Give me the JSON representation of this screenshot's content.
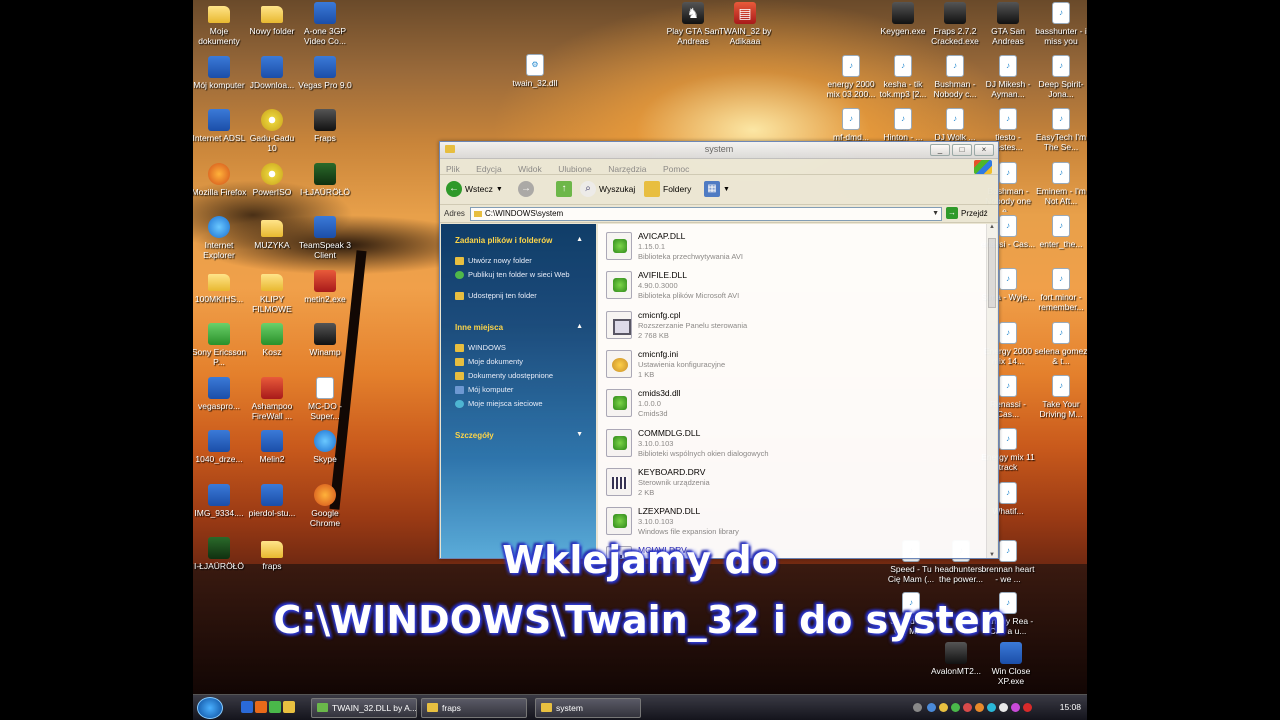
{
  "desktop": {
    "icons_left": [
      {
        "label": "Moje dokumenty",
        "icon": "folder-docs-icon"
      },
      {
        "label": "Nowy folder",
        "icon": "folder-icon"
      },
      {
        "label": "A-one 3GP Video Co...",
        "icon": "app-icon"
      },
      {
        "label": "Mój komputer",
        "icon": "computer-icon"
      },
      {
        "label": "JDownloa...",
        "icon": "jdownloader-icon"
      },
      {
        "label": "Vegas Pro 9.0",
        "icon": "vegas-icon"
      },
      {
        "label": "Internet ADSL",
        "icon": "internet-icon"
      },
      {
        "label": "Gadu-Gadu 10",
        "icon": "gadugadu-icon"
      },
      {
        "label": "Fraps",
        "icon": "fraps-icon"
      },
      {
        "label": "Mozilla Firefox",
        "icon": "firefox-icon"
      },
      {
        "label": "PowerISO",
        "icon": "poweriso-icon"
      },
      {
        "label": "I-ŁJAÜRÖŁÖ",
        "icon": "game-icon"
      },
      {
        "label": "Internet Explorer",
        "icon": "ie-icon"
      },
      {
        "label": "MUZYKA",
        "icon": "folder-icon"
      },
      {
        "label": "TeamSpeak 3 Client",
        "icon": "teamspeak-icon"
      },
      {
        "label": "100MKIHS...",
        "icon": "folder-icon"
      },
      {
        "label": "KLIPY FILMOWE",
        "icon": "folder-icon"
      },
      {
        "label": "metin2.exe",
        "icon": "metin2-icon"
      },
      {
        "label": "Sony Ericsson P...",
        "icon": "sony-icon"
      },
      {
        "label": "Kosz",
        "icon": "recycle-bin-icon"
      },
      {
        "label": "Winamp",
        "icon": "winamp-icon"
      },
      {
        "label": "vegaspro...",
        "icon": "vegas-icon"
      },
      {
        "label": "Ashampoo FireWall ...",
        "icon": "ashampoo-icon"
      },
      {
        "label": "MC-DO - Super...",
        "icon": "mp3-icon"
      },
      {
        "label": "1040_drze...",
        "icon": "image-icon"
      },
      {
        "label": "Melin2",
        "icon": "melin-icon"
      },
      {
        "label": "Skype",
        "icon": "skype-icon"
      },
      {
        "label": "IMG_9334....",
        "icon": "image-icon"
      },
      {
        "label": "pierdol-stu...",
        "icon": "image-icon"
      },
      {
        "label": "Google Chrome",
        "icon": "chrome-icon"
      },
      {
        "label": "I-ŁJAÜRÖŁÖ",
        "icon": "game-icon"
      },
      {
        "label": "fraps",
        "icon": "folder-icon"
      }
    ],
    "icons_top": [
      {
        "label": "twain_32.dll",
        "icon": "dll-icon"
      },
      {
        "label": "Play GTA San Andreas",
        "icon": "gta-icon"
      },
      {
        "label": "TWAIN_32 by Adikaaa",
        "icon": "winrar-icon"
      }
    ],
    "icons_right": [
      {
        "label": "Keygen.exe",
        "icon": "keygen-icon"
      },
      {
        "label": "Fraps 2.7.2 Cracked.exe",
        "icon": "fraps-icon"
      },
      {
        "label": "GTA San Andreas",
        "icon": "gta-icon"
      },
      {
        "label": "basshunter - i miss you",
        "icon": "mp3-icon"
      },
      {
        "label": "energy 2000 mix 03.200...",
        "icon": "mp3-icon"
      },
      {
        "label": "kesha - tik tok.mp3 [2...",
        "icon": "mp3-icon"
      },
      {
        "label": "Bushman - Nobody c...",
        "icon": "mp3-icon"
      },
      {
        "label": "DJ Mikesh - Ayman...",
        "icon": "mp3-icon"
      },
      {
        "label": "Deep Spirit-Jona...",
        "icon": "mp3-icon"
      },
      {
        "label": "mf-dmd...",
        "icon": "mp3-icon"
      },
      {
        "label": "Hinton - ...",
        "icon": "mp3-icon"
      },
      {
        "label": "DJ Wolk ...",
        "icon": "mp3-icon"
      },
      {
        "label": "tiesto - jestes...",
        "icon": "mp3-icon"
      },
      {
        "label": "EasyTech I'm The Se...",
        "icon": "mp3-icon"
      },
      {
        "label": "Bushman - Nobody one e...",
        "icon": "mp3-icon"
      },
      {
        "label": "Eminem - I'm Not Aft...",
        "icon": "mp3-icon"
      },
      {
        "label": "enassi - Cas...",
        "icon": "mp3-icon"
      },
      {
        "label": "enter_the...",
        "icon": "mp3-icon"
      },
      {
        "label": "Sima - Wyje...",
        "icon": "mp3-icon"
      },
      {
        "label": "fort.minor - remember...",
        "icon": "mp3-icon"
      },
      {
        "label": "Energy 2000 mix 14...",
        "icon": "mp3-icon"
      },
      {
        "label": "selena gomez & t...",
        "icon": "mp3-icon"
      },
      {
        "label": "Renassi - Cas...",
        "icon": "mp3-icon"
      },
      {
        "label": "Take Your Driving M...",
        "icon": "mp3-icon"
      },
      {
        "label": "Energy mix 11 track",
        "icon": "mp3-icon"
      },
      {
        "label": "Whatif...",
        "icon": "mp3-icon"
      },
      {
        "label": "Speed - Tu Cię Mam (...",
        "icon": "mp3-icon"
      },
      {
        "label": "headhunters - the power...",
        "icon": "mp3-icon"
      },
      {
        "label": "brennan heart - we ...",
        "icon": "mp3-icon"
      },
      {
        "label": "Speed - Tu Cię Ma...",
        "icon": "mp3-icon"
      },
      {
        "label": "Tammy Rea - Can a u...",
        "icon": "mp3-icon"
      },
      {
        "label": "AvalonMT2...",
        "icon": "avalon-icon"
      },
      {
        "label": "Win Close XP.exe",
        "icon": "winclose-icon"
      }
    ]
  },
  "window": {
    "title": "system",
    "menu": [
      "Plik",
      "Edycja",
      "Widok",
      "Ulubione",
      "Narzędzia",
      "Pomoc"
    ],
    "toolbar": {
      "back": "Wstecz",
      "search": "Wyszukaj",
      "folders": "Foldery"
    },
    "address": {
      "label": "Adres",
      "value": "C:\\WINDOWS\\system",
      "go": "Przejdź"
    },
    "sidebar": {
      "tasks_title": "Zadania plików i folderów",
      "tasks": [
        "Utwórz nowy folder",
        "Publikuj ten folder w sieci Web",
        "Udostępnij ten folder"
      ],
      "places_title": "Inne miejsca",
      "places": [
        "WINDOWS",
        "Moje dokumenty",
        "Dokumenty udostępnione",
        "Mój komputer",
        "Moje miejsca sieciowe"
      ],
      "details_title": "Szczegóły"
    },
    "files": [
      {
        "name": "AVICAP.DLL",
        "version": "1.15.0.1",
        "desc": "Biblioteka przechwytywania AVI",
        "type": "dll"
      },
      {
        "name": "AVIFILE.DLL",
        "version": "4.90.0.3000",
        "desc": "Biblioteka plików Microsoft AVI",
        "type": "dll"
      },
      {
        "name": "cmicnfg.cpl",
        "version": "Rozszerzanie Panelu sterowania",
        "desc": "2 768 KB",
        "type": "cpl"
      },
      {
        "name": "cmicnfg.ini",
        "version": "Ustawienia konfiguracyjne",
        "desc": "1 KB",
        "type": "ini"
      },
      {
        "name": "cmids3d.dll",
        "version": "1.0.0.0",
        "desc": "Cmids3d",
        "type": "dll"
      },
      {
        "name": "COMMDLG.DLL",
        "version": "3.10.0.103",
        "desc": "Biblioteki wspólnych okien dialogowych",
        "type": "dll"
      },
      {
        "name": "KEYBOARD.DRV",
        "version": "Sterownik urządzenia",
        "desc": "2 KB",
        "type": "drv"
      },
      {
        "name": "LZEXPAND.DLL",
        "version": "3.10.0.103",
        "desc": "Windows file expansion library",
        "type": "dll"
      },
      {
        "name": "MCIAVI.DRV",
        "version": "",
        "desc": "",
        "type": "drv"
      }
    ]
  },
  "subtitle": {
    "line1": "Wklejamy do",
    "line2": "C:\\WINDOWS\\Twain_32 i do systen"
  },
  "taskbar": {
    "buttons": [
      "TWAIN_32.DLL by A...",
      "fraps",
      "system"
    ],
    "clock": "15:08"
  }
}
